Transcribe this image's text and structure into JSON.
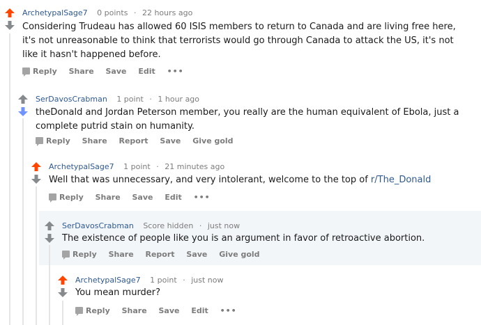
{
  "colors": {
    "upvoted": "#ff4500",
    "downvoted": "#7193ff",
    "neutral": "#878a8c",
    "author": "#2f5990"
  },
  "comments": [
    {
      "author": "ArchetypalSage7",
      "score": "0 points",
      "time": "22 hours ago",
      "vote": "up",
      "text": "Considering Trudeau has allowed 60 ISIS members to return to Canada and are living free here, it's not unreasonable to think that terrorists would go through Canada to attack the US, it's not like it hasn't happened before.",
      "actions": [
        "Reply",
        "Share",
        "Save",
        "Edit"
      ]
    },
    {
      "author": "SerDavosCrabman",
      "score": "1 point",
      "time": "1 hour ago",
      "vote": "down",
      "text": "theDonald and Jordan Peterson member, you really are the human equivalent of Ebola, just a complete putrid stain on humanity.",
      "actions": [
        "Reply",
        "Share",
        "Report",
        "Save",
        "Give gold"
      ]
    },
    {
      "author": "ArchetypalSage7",
      "score": "1 point",
      "time": "21 minutes ago",
      "vote": "up",
      "text": "Well that was unnecessary, and very intolerant, welcome to the top of ",
      "link": "r/The_Donald",
      "actions": [
        "Reply",
        "Share",
        "Save",
        "Edit"
      ]
    },
    {
      "author": "SerDavosCrabman",
      "score": "Score hidden",
      "time": "just now",
      "vote": "none",
      "text": "The existence of people like you is an argument in favor of retroactive abortion.",
      "actions": [
        "Reply",
        "Share",
        "Report",
        "Save",
        "Give gold"
      ]
    },
    {
      "author": "ArchetypalSage7",
      "score": "1 point",
      "time": "just now",
      "vote": "up",
      "text": "You mean murder?",
      "actions": [
        "Reply",
        "Share",
        "Save",
        "Edit"
      ]
    }
  ],
  "more_label": "•••"
}
